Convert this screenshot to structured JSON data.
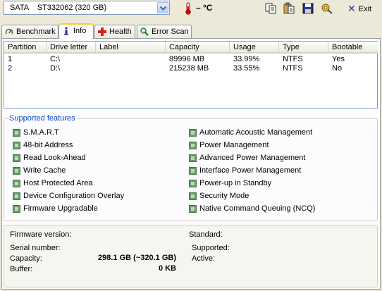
{
  "toolbar": {
    "drive_select_value": "SATA    ST332062 (320 GB)",
    "temperature": "– °C",
    "exit_label": "Exit"
  },
  "tabs": [
    {
      "label": "Benchmark",
      "active": false
    },
    {
      "label": "Info",
      "active": true
    },
    {
      "label": "Health",
      "active": false
    },
    {
      "label": "Error Scan",
      "active": false
    }
  ],
  "partitions": {
    "columns": [
      "Partition",
      "Drive letter",
      "Label",
      "Capacity",
      "Usage",
      "Type",
      "Bootable"
    ],
    "rows": [
      {
        "partition": "1",
        "drive": "C:\\",
        "label": "",
        "capacity": "89996 MB",
        "usage": "33.99%",
        "type": "NTFS",
        "bootable": "Yes"
      },
      {
        "partition": "2",
        "drive": "D:\\",
        "label": "",
        "capacity": "215238 MB",
        "usage": "33.55%",
        "type": "NTFS",
        "bootable": "No"
      }
    ]
  },
  "features": {
    "title": "Supported features",
    "left": [
      "S.M.A.R.T",
      "48-bit Address",
      "Read Look-Ahead",
      "Write Cache",
      "Host Protected Area",
      "Device Configuration Overlay",
      "Firmware Upgradable"
    ],
    "right": [
      "Automatic Acoustic Management",
      "Power Management",
      "Advanced Power Management",
      "Interface Power Management",
      "Power-up in Standby",
      "Security Mode",
      "Native Command Queuing (NCQ)"
    ]
  },
  "info": {
    "firmware_label": "Firmware version:",
    "serial_label": "Serial number:",
    "capacity_label": "Capacity:",
    "capacity_value": "298.1 GB (~320.1 GB)",
    "buffer_label": "Buffer:",
    "buffer_value": "0 KB",
    "standard_label": "Standard:",
    "supported_label": "Supported:",
    "active_label": "Active:"
  },
  "colors": {
    "accent": "#0046d5",
    "tab_highlight": "#ffc83c",
    "feature_check": "#6a9b6a"
  }
}
